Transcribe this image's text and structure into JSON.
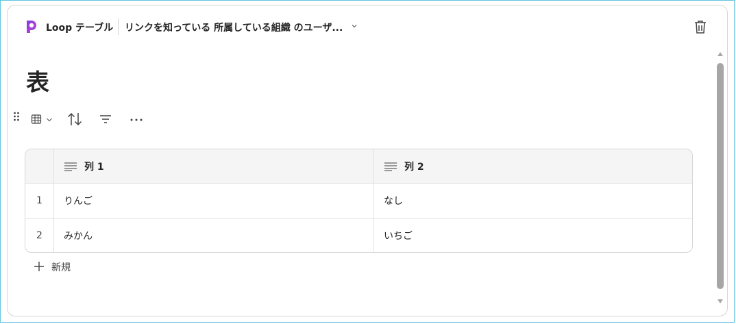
{
  "header": {
    "app_name": "Loop テーブル",
    "share_text": "リンクを知っている 所属している組織 のユーザ...",
    "icons": [
      "loop-logo-icon",
      "chevron-down-icon",
      "trash-icon"
    ]
  },
  "title": "表",
  "toolbar": {
    "icons": [
      "drag-handle-icon",
      "table-view-icon",
      "chevron-down-icon",
      "sort-icon",
      "filter-icon",
      "more-icon"
    ]
  },
  "table": {
    "columns": [
      {
        "label": "列 1",
        "icon": "text-column-icon"
      },
      {
        "label": "列 2",
        "icon": "text-column-icon"
      }
    ],
    "rows": [
      {
        "index": "1",
        "cells": [
          "りんご",
          "なし"
        ]
      },
      {
        "index": "2",
        "cells": [
          "みかん",
          "いちご"
        ]
      }
    ]
  },
  "new_row_label": "新規",
  "colors": {
    "accent_frame": "#5fc4dd",
    "text": "#242424",
    "header_bg": "#f5f5f5",
    "scrollbar": "#a6a6a6"
  }
}
